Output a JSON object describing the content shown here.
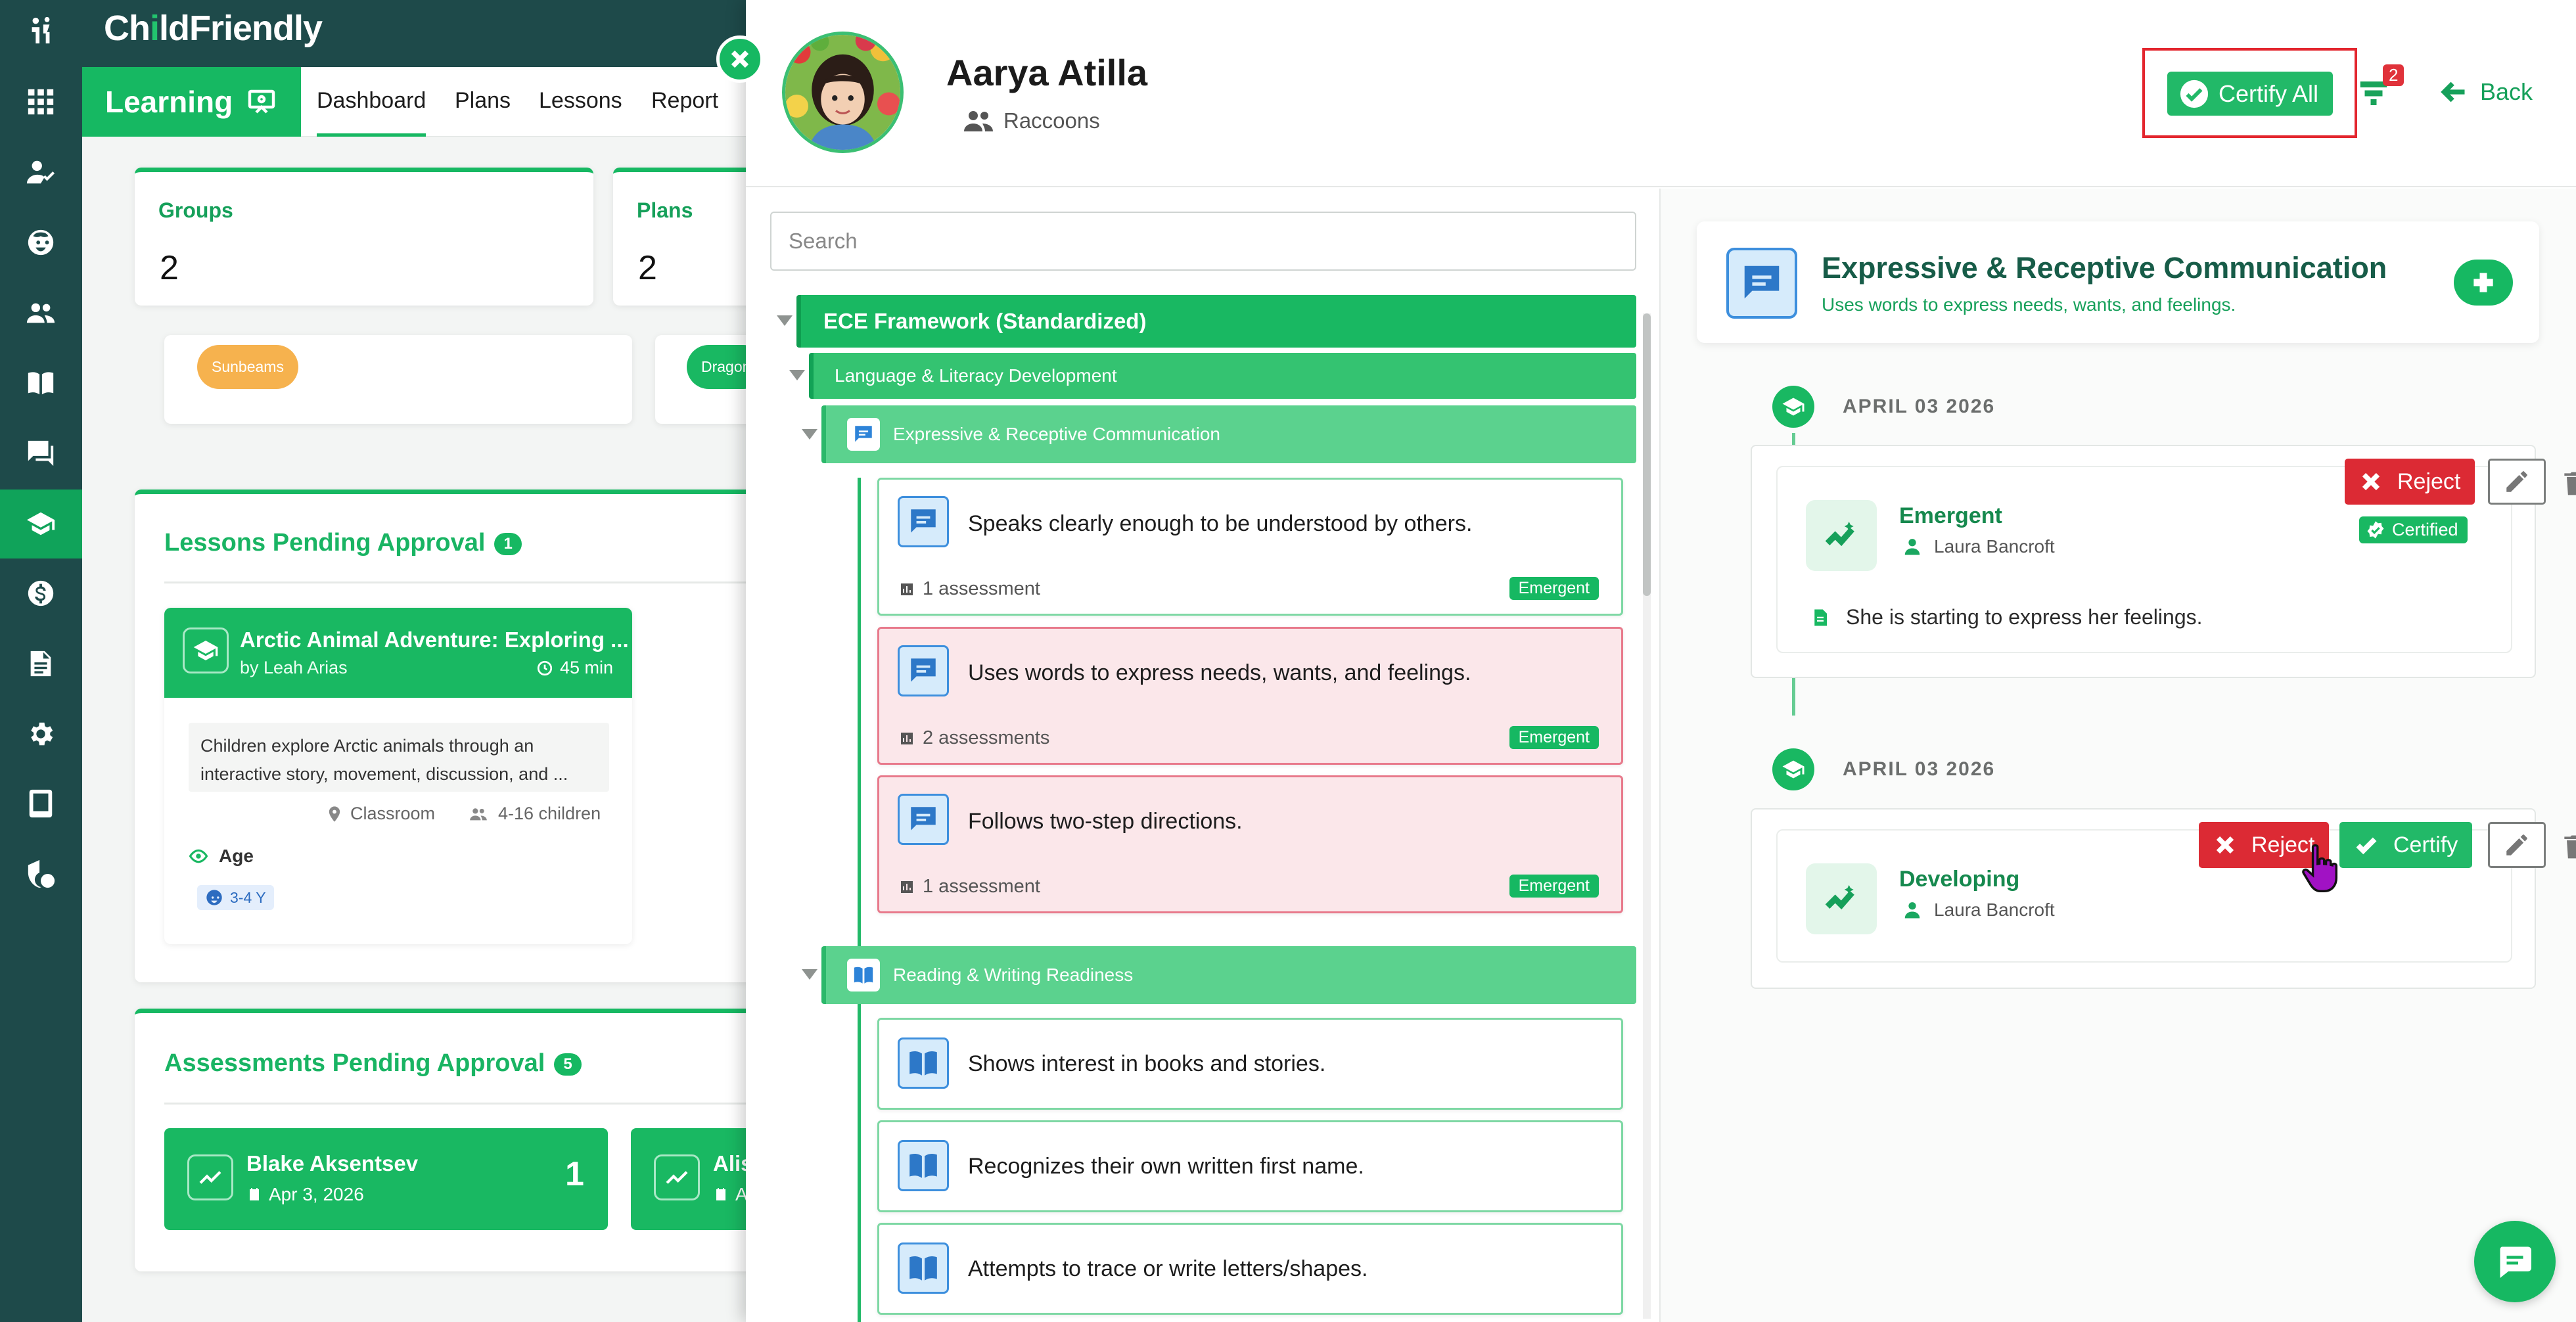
{
  "app": {
    "logo_prefix": "Ch",
    "logo_i": "i",
    "logo_mid": "ld",
    "logo_suffix": "Friendly"
  },
  "rail": {
    "icons": [
      "apps-icon",
      "person-check-icon",
      "child-face-icon",
      "people-icon",
      "book-icon",
      "chat-icon",
      "learning-icon",
      "dollar-icon",
      "document-icon",
      "gear-icon",
      "tablet-icon",
      "shield-icon"
    ],
    "active": "learning-icon"
  },
  "subnav": {
    "section": "Learning",
    "tabs": [
      "Dashboard",
      "Plans",
      "Lessons",
      "Report"
    ],
    "active_tab": "Dashboard"
  },
  "dashboard": {
    "stats": [
      {
        "label": "Groups",
        "value": "2"
      },
      {
        "label": "Plans",
        "value": "2"
      }
    ],
    "group_chips": [
      "Sunbeams",
      "Dragon"
    ],
    "lessons_pending": {
      "title": "Lessons Pending Approval",
      "count": "1",
      "lesson": {
        "title": "Arctic Animal Adventure: Exploring ...",
        "author": "by Leah Arias",
        "duration": "45 min",
        "description_line1": "Children explore Arctic animals through an",
        "description_line2": "interactive story, movement, discussion, and ...",
        "location": "Classroom",
        "group_size": "4-16 children",
        "age_label": "Age",
        "age_value": "3-4 Y"
      }
    },
    "assessments_pending": {
      "title": "Assessments Pending Approval",
      "count": "5",
      "items": [
        {
          "name": "Blake Aksentsev",
          "date": "Apr 3, 2026",
          "count": "1"
        },
        {
          "name": "Alis",
          "date": "A"
        }
      ]
    }
  },
  "panel": {
    "child_name": "Aarya Atilla",
    "group": "Raccoons",
    "certify_all_label": "Certify All",
    "filter_badge": "2",
    "back_label": "Back",
    "search_placeholder": "Search",
    "tree": {
      "framework": "ECE Framework (Standardized)",
      "domain": "Language & Literacy Development",
      "subdomains": [
        {
          "name": "Expressive & Receptive Communication",
          "skills": [
            {
              "text": "Speaks clearly enough to be understood by others.",
              "assessments": "1 assessment",
              "level": "Emergent",
              "flagged": false
            },
            {
              "text": "Uses words to express needs, wants, and feelings.",
              "assessments": "2 assessments",
              "level": "Emergent",
              "flagged": true
            },
            {
              "text": "Follows two-step directions.",
              "assessments": "1 assessment",
              "level": "Emergent",
              "flagged": true
            }
          ]
        },
        {
          "name": "Reading & Writing Readiness",
          "skills": [
            {
              "text": "Shows interest in books and stories."
            },
            {
              "text": "Recognizes their own written first name."
            },
            {
              "text": "Attempts to trace or write letters/shapes."
            }
          ]
        }
      ]
    },
    "detail": {
      "title": "Expressive & Receptive Communication",
      "subtitle": "Uses words to express needs, wants, and feelings.",
      "entries": [
        {
          "date": "APRIL 03 2026",
          "level": "Emergent",
          "teacher": "Laura Bancroft",
          "status": "Certified",
          "note": "She is starting to express her feelings.",
          "reject_label": "Reject"
        },
        {
          "date": "APRIL 03 2026",
          "level": "Developing",
          "teacher": "Laura Bancroft",
          "reject_label": "Reject",
          "certify_label": "Certify"
        }
      ]
    }
  },
  "colors": {
    "brand_green": "#16b862",
    "rail_bg": "#1e4a4a",
    "reject_red": "#dc2a34",
    "flag_bg": "#fbe7ea"
  }
}
